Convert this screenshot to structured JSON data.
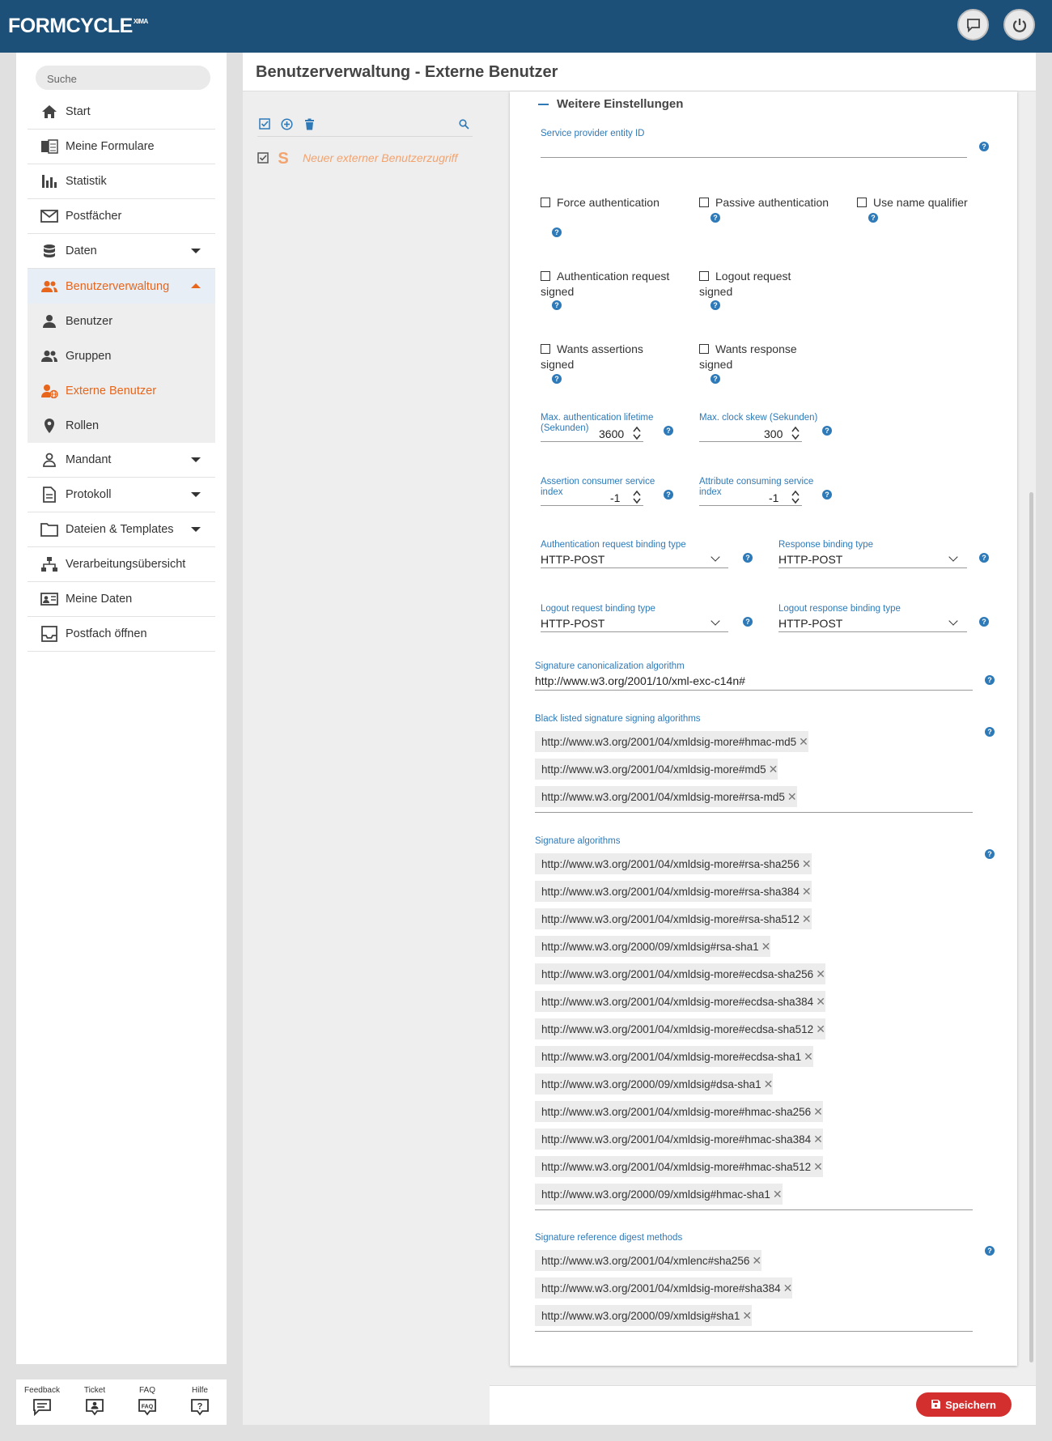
{
  "app": {
    "logo": "FORMCYCLE",
    "logo_sup": "XIMA"
  },
  "sidebar": {
    "search_placeholder": "Suche",
    "items": [
      {
        "label": "Start",
        "icon": "home-icon"
      },
      {
        "label": "Meine Formulare",
        "icon": "forms-icon"
      },
      {
        "label": "Statistik",
        "icon": "bar-chart-icon"
      },
      {
        "label": "Postfächer",
        "icon": "mail-icon"
      },
      {
        "label": "Daten",
        "icon": "database-icon"
      },
      {
        "label": "Benutzerverwaltung",
        "icon": "users-icon"
      }
    ],
    "subitems": [
      {
        "label": "Benutzer"
      },
      {
        "label": "Gruppen"
      },
      {
        "label": "Externe Benutzer"
      },
      {
        "label": "Rollen"
      }
    ],
    "items2": [
      {
        "label": "Mandant"
      },
      {
        "label": "Protokoll"
      },
      {
        "label": "Dateien & Templates"
      },
      {
        "label": "Verarbeitungsübersicht"
      },
      {
        "label": "Meine Daten"
      },
      {
        "label": "Postfach öffnen"
      }
    ],
    "footer": [
      "Feedback",
      "Ticket",
      "FAQ",
      "Hilfe"
    ]
  },
  "header": {
    "title": "Benutzerverwaltung - Externe Benutzer"
  },
  "list": {
    "item_label": "Neuer externer Benutzerzugriff"
  },
  "form": {
    "section_title": "Weitere Einstellungen",
    "sp_entity_id_label": "Service provider entity ID",
    "checkboxes": {
      "force_auth": "Force authentication",
      "passive_auth": "Passive authentication",
      "use_name_qualifier": "Use name qualifier",
      "auth_req_signed": "Authentication request signed",
      "logout_req_signed": "Logout request signed",
      "wants_assertions_signed": "Wants assertions signed",
      "wants_response_signed": "Wants response signed"
    },
    "max_auth_lifetime": {
      "label": "Max. authentication lifetime (Sekunden)",
      "value": "3600"
    },
    "max_clock_skew": {
      "label": "Max. clock skew (Sekunden)",
      "value": "300"
    },
    "acs_index": {
      "label": "Assertion consumer service index",
      "value": "-1"
    },
    "attr_index": {
      "label": "Attribute consuming service index",
      "value": "-1"
    },
    "auth_binding": {
      "label": "Authentication request binding type",
      "value": "HTTP-POST"
    },
    "resp_binding": {
      "label": "Response binding type",
      "value": "HTTP-POST"
    },
    "logout_req_binding": {
      "label": "Logout request binding type",
      "value": "HTTP-POST"
    },
    "logout_resp_binding": {
      "label": "Logout response binding type",
      "value": "HTTP-POST"
    },
    "sig_canon": {
      "label": "Signature canonicalization algorithm",
      "value": "http://www.w3.org/2001/10/xml-exc-c14n#"
    },
    "blacklisted": {
      "label": "Black listed signature signing algorithms",
      "chips": [
        "http://www.w3.org/2001/04/xmldsig-more#hmac-md5",
        "http://www.w3.org/2001/04/xmldsig-more#md5",
        "http://www.w3.org/2001/04/xmldsig-more#rsa-md5"
      ]
    },
    "sig_algs": {
      "label": "Signature algorithms",
      "chips": [
        "http://www.w3.org/2001/04/xmldsig-more#rsa-sha256",
        "http://www.w3.org/2001/04/xmldsig-more#rsa-sha384",
        "http://www.w3.org/2001/04/xmldsig-more#rsa-sha512",
        "http://www.w3.org/2000/09/xmldsig#rsa-sha1",
        "http://www.w3.org/2001/04/xmldsig-more#ecdsa-sha256",
        "http://www.w3.org/2001/04/xmldsig-more#ecdsa-sha384",
        "http://www.w3.org/2001/04/xmldsig-more#ecdsa-sha512",
        "http://www.w3.org/2001/04/xmldsig-more#ecdsa-sha1",
        "http://www.w3.org/2000/09/xmldsig#dsa-sha1",
        "http://www.w3.org/2001/04/xmldsig-more#hmac-sha256",
        "http://www.w3.org/2001/04/xmldsig-more#hmac-sha384",
        "http://www.w3.org/2001/04/xmldsig-more#hmac-sha512",
        "http://www.w3.org/2000/09/xmldsig#hmac-sha1"
      ]
    },
    "digest": {
      "label": "Signature reference digest methods",
      "chips": [
        "http://www.w3.org/2001/04/xmlenc#sha256",
        "http://www.w3.org/2001/04/xmldsig-more#sha384",
        "http://www.w3.org/2000/09/xmldsig#sha1"
      ]
    }
  },
  "save_label": "Speichern"
}
